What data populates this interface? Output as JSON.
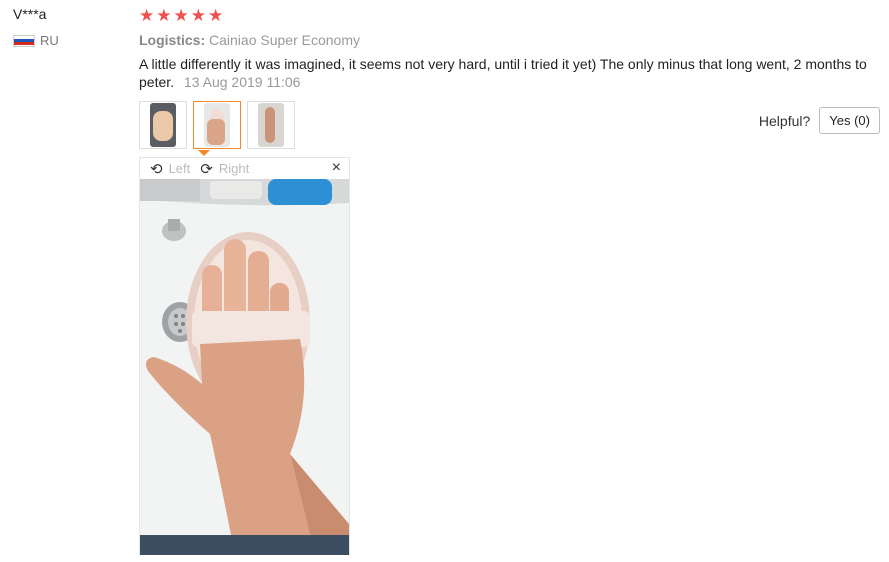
{
  "review": {
    "user": "V***a",
    "country": "RU",
    "rating": 5,
    "stars": [
      "★",
      "★",
      "★",
      "★",
      "★"
    ],
    "logistics_label": "Logistics:",
    "logistics_value": "Cainiao Super Economy",
    "text": "A little differently it was imagined, it seems not very hard, until i tried it yet) The only minus that long went, 2 months to peter.",
    "date": "13 Aug 2019 11:06"
  },
  "helpful": {
    "label": "Helpful?",
    "yes": "Yes (0)"
  },
  "viewer": {
    "rotate_left": "Left",
    "rotate_right": "Right",
    "close": "×",
    "selected_index": 1
  },
  "thumbnails": [
    {
      "name": "photo-thumb-1"
    },
    {
      "name": "photo-thumb-2"
    },
    {
      "name": "photo-thumb-3"
    }
  ],
  "colors": {
    "star": "#f0504f",
    "active_thumb": "#f08a2a",
    "flag": [
      "#ffffff",
      "#1c57b8",
      "#d52b1e"
    ]
  }
}
